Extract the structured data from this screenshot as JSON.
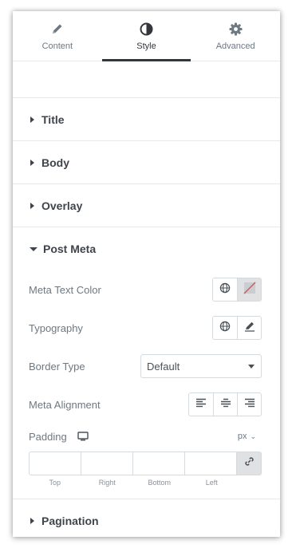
{
  "tabs": [
    {
      "label": "Content",
      "icon": "pencil-icon"
    },
    {
      "label": "Style",
      "icon": "contrast-icon"
    },
    {
      "label": "Advanced",
      "icon": "gear-icon"
    }
  ],
  "active_tab": "Style",
  "sections": {
    "title": "Title",
    "body": "Body",
    "overlay": "Overlay",
    "post_meta": "Post Meta",
    "pagination": "Pagination"
  },
  "controls": {
    "meta_text_color": "Meta Text Color",
    "typography": "Typography",
    "border_type": "Border Type",
    "border_type_value": "Default",
    "meta_alignment": "Meta Alignment",
    "padding": "Padding",
    "padding_unit": "px"
  },
  "padding_labels": [
    "Top",
    "Right",
    "Bottom",
    "Left"
  ],
  "colors": {
    "accent": "#33373d",
    "border": "#d5dadf",
    "shaded_button": "#dfe1e3",
    "slash": "#d9534f"
  }
}
